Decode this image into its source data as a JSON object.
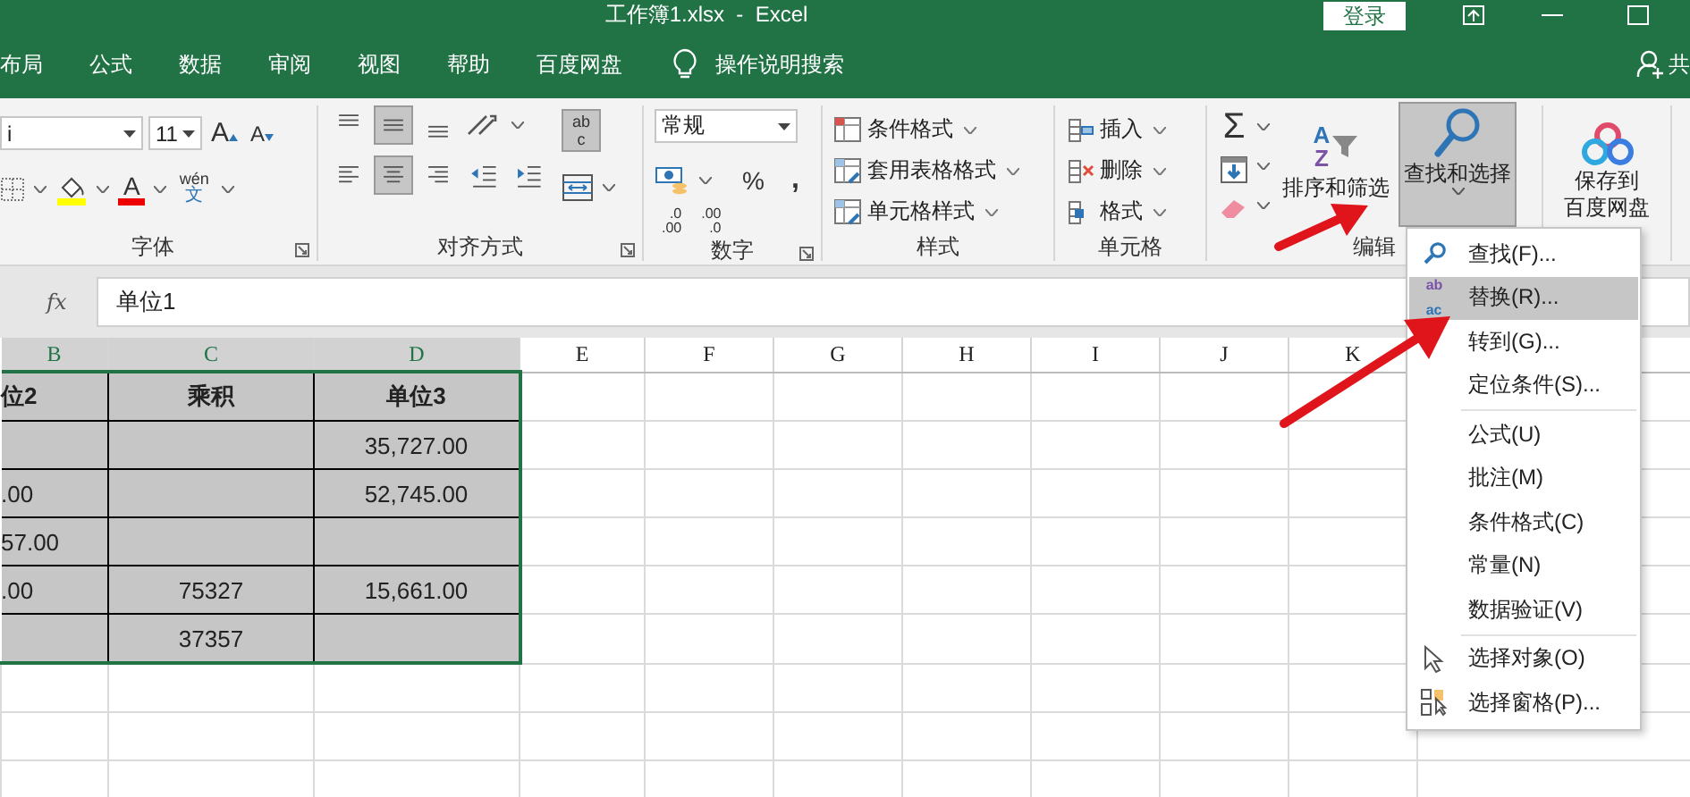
{
  "window": {
    "title": "工作簿1.xlsx  -  Excel",
    "sign_in": "登录"
  },
  "tabs": [
    {
      "label": "布局"
    },
    {
      "label": "公式"
    },
    {
      "label": "数据"
    },
    {
      "label": "审阅"
    },
    {
      "label": "视图"
    },
    {
      "label": "帮助"
    },
    {
      "label": "百度网盘"
    }
  ],
  "tell_me": "操作说明搜索",
  "share": "共",
  "font_group": {
    "font_name": "i",
    "font_size": "11",
    "grow": "A",
    "shrink": "A",
    "font_color": "A",
    "phonetic_top": "wén",
    "phonetic_bottom": "文",
    "label": "字体"
  },
  "alignment_group": {
    "row1": [
      {
        "kind": "top",
        "pressed": false
      },
      {
        "kind": "middle",
        "pressed": true
      },
      {
        "kind": "bottom",
        "pressed": false
      }
    ],
    "row2": [
      {
        "kind": "left",
        "pressed": false
      },
      {
        "kind": "center",
        "pressed": true
      },
      {
        "kind": "right",
        "pressed": false
      },
      {
        "kind": "outdent",
        "pressed": false
      },
      {
        "kind": "indent",
        "pressed": false
      }
    ],
    "wrap_top": "ab",
    "wrap_bottom": "c",
    "wrap_pressed": true,
    "label": "对齐方式"
  },
  "number_group": {
    "format": "常规",
    "percent": "%",
    "comma": ",",
    "increase_decimal": [
      ".0",
      ".00"
    ],
    "decrease_decimal": [
      ".00",
      ".0"
    ],
    "label": "数字"
  },
  "styles_group": {
    "items": [
      "条件格式",
      "套用表格格式",
      "单元格样式"
    ],
    "label": "样式"
  },
  "cells_group": {
    "items": [
      "插入",
      "删除",
      "格式"
    ],
    "label": "单元格"
  },
  "editing_group": {
    "sum": "Σ",
    "sort_letters": [
      "A",
      "Z"
    ],
    "sort_label": "排序和筛选",
    "find_label": "查找和选择",
    "find_pressed": true,
    "label": "编辑"
  },
  "baidu": {
    "label_lines": [
      "保存到",
      "百度网盘"
    ]
  },
  "formula_bar": {
    "fx": "fx",
    "value": "单位1"
  },
  "columns": [
    "B",
    "C",
    "D",
    "E",
    "F",
    "G",
    "H",
    "I",
    "J",
    "K"
  ],
  "rows": [
    {
      "header": true,
      "cells": [
        "位2",
        "乘积",
        "单位3"
      ]
    },
    {
      "header": false,
      "cells": [
        "",
        "",
        "35,727.00"
      ]
    },
    {
      "header": false,
      "cells": [
        ".00",
        "",
        "52,745.00"
      ]
    },
    {
      "header": false,
      "cells": [
        "57.00",
        "",
        ""
      ]
    },
    {
      "header": false,
      "cells": [
        ".00",
        "75327",
        "15,661.00"
      ]
    },
    {
      "header": false,
      "cells": [
        "",
        "37357",
        ""
      ]
    }
  ],
  "menu": {
    "items": [
      {
        "kind": "find",
        "label": "查找(F)...",
        "selected": false
      },
      {
        "kind": "replace",
        "label": "替换(R)...",
        "selected": true,
        "icon_text": [
          "ab",
          "ac"
        ]
      },
      {
        "kind": "plain",
        "label": "转到(G)...",
        "selected": false
      },
      {
        "kind": "plain",
        "label": "定位条件(S)...",
        "selected": false
      },
      {
        "kind": "separator"
      },
      {
        "kind": "plain",
        "label": "公式(U)",
        "selected": false
      },
      {
        "kind": "plain",
        "label": "批注(M)",
        "selected": false
      },
      {
        "kind": "plain",
        "label": "条件格式(C)",
        "selected": false
      },
      {
        "kind": "plain",
        "label": "常量(N)",
        "selected": false
      },
      {
        "kind": "plain",
        "label": "数据验证(V)",
        "selected": false
      },
      {
        "kind": "separator"
      },
      {
        "kind": "select_objects",
        "label": "选择对象(O)",
        "selected": false
      },
      {
        "kind": "selection_pane",
        "label": "选择窗格(P)...",
        "selected": false
      }
    ]
  }
}
